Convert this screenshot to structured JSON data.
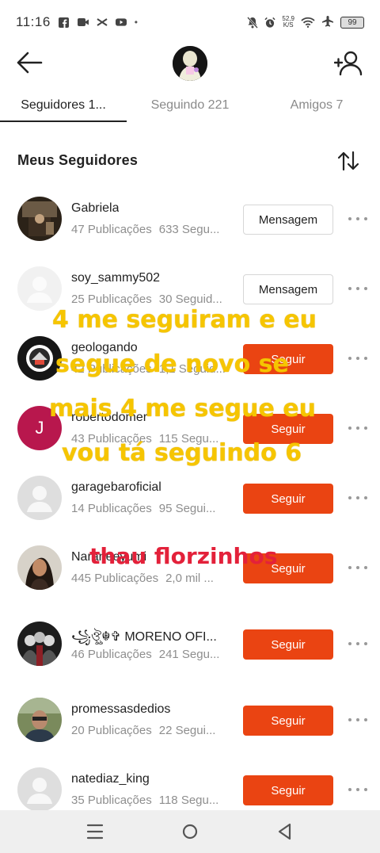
{
  "status_bar": {
    "time": "11:16",
    "dot": "•",
    "net_speed_top": "52,9",
    "net_speed_bottom": "K/S",
    "battery": "99",
    "left_icons": [
      "facebook-icon",
      "video-icon",
      "capcut-icon",
      "youtube-icon"
    ],
    "right_icons": [
      "mute-icon",
      "alarm-icon",
      "wifi-icon",
      "airplane-icon",
      "battery-icon"
    ]
  },
  "header": {
    "back_icon": "arrow-left-icon",
    "add_user_icon": "add-user-icon"
  },
  "tabs": [
    {
      "label": "Seguidores 1..."
    },
    {
      "label": "Seguindo 221"
    },
    {
      "label": "Amigos 7"
    }
  ],
  "section": {
    "title": "Meus Seguidores",
    "sort_icon": "sort-icon"
  },
  "followers": [
    {
      "name": "Gabriela",
      "posts": "47 Publicações",
      "followers": "633 Segu...",
      "button": "Mensagem",
      "button_type": "message"
    },
    {
      "name": "soy_sammy502",
      "posts": "25 Publicações",
      "followers": "30 Seguid...",
      "button": "Mensagem",
      "button_type": "message"
    },
    {
      "name": "geologando",
      "posts": "42 Publicações",
      "followers": "1,1 Seguid...",
      "button": "Seguir",
      "button_type": "follow"
    },
    {
      "name": "robertodomer",
      "posts": "43 Publicações",
      "followers": "115 Segu...",
      "button": "Seguir",
      "button_type": "follow",
      "avatar_letter": "J"
    },
    {
      "name": "garagebaroficial",
      "posts": "14 Publicações",
      "followers": "95 Segui...",
      "button": "Seguir",
      "button_type": "follow"
    },
    {
      "name": "Naraneeyumi",
      "posts": "445 Publicações",
      "followers": "2,0 mil ...",
      "button": "Seguir",
      "button_type": "follow"
    },
    {
      "name": "꧁ঔৣ☬✞ MORENO OFI...",
      "posts": "46 Publicações",
      "followers": "241 Segu...",
      "button": "Seguir",
      "button_type": "follow"
    },
    {
      "name": "promessasdedios",
      "posts": "20 Publicações",
      "followers": "22 Segui...",
      "button": "Seguir",
      "button_type": "follow"
    },
    {
      "name": "natediaz_king",
      "posts": "35 Publicações",
      "followers": "118 Segu...",
      "button": "Seguir",
      "button_type": "follow"
    }
  ],
  "overlay": {
    "line1": "4 me seguiram e eu",
    "line2": "segue de novo se",
    "line3": "mais 4 me segue eu",
    "line4": "vou tá seguindo 6",
    "line5": "thau florzinhos"
  },
  "colors": {
    "accent": "#ea4412",
    "overlay_yellow": "#f6c500",
    "overlay_red": "#e3213a"
  },
  "navbar": {
    "icons": [
      "menu-icon",
      "home-circle-icon",
      "back-triangle-icon"
    ]
  }
}
